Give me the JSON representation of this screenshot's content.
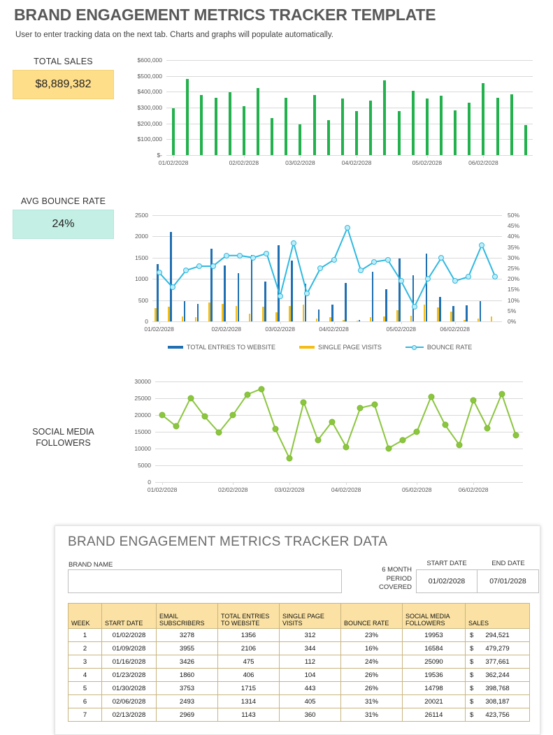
{
  "header": {
    "title": "BRAND ENGAGEMENT METRICS TRACKER TEMPLATE",
    "subtitle": "User to enter tracking data on the next tab. Charts and graphs will populate automatically."
  },
  "kpis": {
    "total_sales_label": "TOTAL SALES",
    "total_sales_value": "$8,889,382",
    "total_sales_color": "#FFDE8A",
    "bounce_label": "AVG BOUNCE RATE",
    "bounce_value": "24%",
    "bounce_color": "#C4EFE4",
    "social_label_line1": "SOCIAL MEDIA",
    "social_label_line2": "FOLLOWERS"
  },
  "legend2": {
    "item1": "TOTAL ENTRIES TO WEBSITE",
    "item2": "SINGLE PAGE VISITS",
    "item3": "BOUNCE RATE",
    "color1": "#1F6FB2",
    "color2": "#F5BE17",
    "color3": "#2FB9E0"
  },
  "data_card": {
    "title": "BRAND ENGAGEMENT METRICS TRACKER DATA",
    "brand_name_label": "BRAND NAME",
    "brand_name_value": "",
    "brand_name_placeholder": "",
    "period_label": "6 MONTH PERIOD COVERED",
    "start_date_label": "START DATE",
    "end_date_label": "END DATE",
    "start_date_value": "01/02/2028",
    "end_date_value": "07/01/2028",
    "columns": [
      "WEEK",
      "START DATE",
      "EMAIL SUBSCRIBERS",
      "TOTAL ENTRIES TO WEBSITE",
      "SINGLE PAGE VISITS",
      "BOUNCE RATE",
      "SOCIAL MEDIA FOLLOWERS",
      "SALES"
    ],
    "rows": [
      {
        "week": "1",
        "start_date": "01/02/2028",
        "email": "3278",
        "entries": "1356",
        "single": "312",
        "bounce": "23%",
        "followers": "19953",
        "sales": "294,521"
      },
      {
        "week": "2",
        "start_date": "01/09/2028",
        "email": "3955",
        "entries": "2106",
        "single": "344",
        "bounce": "16%",
        "followers": "16584",
        "sales": "479,279"
      },
      {
        "week": "3",
        "start_date": "01/16/2028",
        "email": "3426",
        "entries": "475",
        "single": "112",
        "bounce": "24%",
        "followers": "25090",
        "sales": "377,661"
      },
      {
        "week": "4",
        "start_date": "01/23/2028",
        "email": "1860",
        "entries": "406",
        "single": "104",
        "bounce": "26%",
        "followers": "19536",
        "sales": "362,244"
      },
      {
        "week": "5",
        "start_date": "01/30/2028",
        "email": "3753",
        "entries": "1715",
        "single": "443",
        "bounce": "26%",
        "followers": "14798",
        "sales": "398,768"
      },
      {
        "week": "6",
        "start_date": "02/06/2028",
        "email": "2493",
        "entries": "1314",
        "single": "405",
        "bounce": "31%",
        "followers": "20021",
        "sales": "308,187"
      },
      {
        "week": "7",
        "start_date": "02/13/2028",
        "email": "2969",
        "entries": "1143",
        "single": "360",
        "bounce": "31%",
        "followers": "26114",
        "sales": "423,756"
      }
    ],
    "currency_symbol": "$"
  },
  "chart_data": [
    {
      "type": "bar",
      "id": "sales-chart",
      "title": "",
      "xlabel": "",
      "ylabel": "",
      "ylim": [
        0,
        600000
      ],
      "yticks": [
        "$-",
        "$100,000",
        "$200,000",
        "$300,000",
        "$400,000",
        "$500,000",
        "$600,000"
      ],
      "ytick_values": [
        0,
        100000,
        200000,
        300000,
        400000,
        500000,
        600000
      ],
      "xticks": [
        "01/02/2028",
        "02/02/2028",
        "03/02/2028",
        "04/02/2028",
        "05/02/2028",
        "06/02/2028"
      ],
      "xtick_indices": [
        0,
        5,
        9,
        13,
        18,
        22
      ],
      "grid": true,
      "legend": "none",
      "color": "#22B14C",
      "categories": [
        "1",
        "2",
        "3",
        "4",
        "5",
        "6",
        "7",
        "8",
        "9",
        "10",
        "11",
        "12",
        "13",
        "14",
        "15",
        "16",
        "17",
        "18",
        "19",
        "20",
        "21",
        "22",
        "23",
        "24",
        "25",
        "26"
      ],
      "values": [
        294521,
        479279,
        377661,
        362244,
        398768,
        308187,
        423756,
        234000,
        361000,
        193000,
        378000,
        222000,
        357000,
        277000,
        344000,
        470000,
        277000,
        407000,
        356000,
        377000,
        281000,
        331000,
        453000,
        361000,
        382000,
        189000
      ]
    },
    {
      "type": "bar-line-combo",
      "id": "traffic-chart",
      "title": "",
      "xlabel": "",
      "ylim": [
        0,
        2500
      ],
      "yticks": [
        "0",
        "500",
        "1000",
        "1500",
        "2000",
        "2500"
      ],
      "ytick_values": [
        0,
        500,
        1000,
        1500,
        2000,
        2500
      ],
      "y2lim": [
        0,
        0.5
      ],
      "y2ticks": [
        "0%",
        "5%",
        "10%",
        "15%",
        "20%",
        "25%",
        "30%",
        "35%",
        "40%",
        "45%",
        "50%"
      ],
      "y2tick_values": [
        0,
        5,
        10,
        15,
        20,
        25,
        30,
        35,
        40,
        45,
        50
      ],
      "xticks": [
        "01/02/2028",
        "02/02/2028",
        "03/02/2028",
        "04/02/2028",
        "05/02/2028",
        "06/02/2028"
      ],
      "xtick_indices": [
        0,
        5,
        9,
        13,
        18,
        22
      ],
      "grid": true,
      "legend": "bottom",
      "series": [
        {
          "name": "TOTAL ENTRIES TO WEBSITE",
          "type": "bar",
          "color": "#1F6FB2",
          "axis": "left",
          "values": [
            1356,
            2106,
            475,
            406,
            1715,
            1314,
            1143,
            1568,
            940,
            1790,
            1430,
            880,
            280,
            400,
            910,
            30,
            1160,
            760,
            1480,
            1090,
            1600,
            570,
            360,
            380,
            480,
            0
          ]
        },
        {
          "name": "SINGLE PAGE VISITS",
          "type": "bar",
          "color": "#F5BE17",
          "axis": "left",
          "values": [
            312,
            344,
            112,
            104,
            443,
            405,
            360,
            185,
            350,
            220,
            360,
            390,
            70,
            95,
            25,
            15,
            95,
            120,
            270,
            125,
            390,
            330,
            230,
            40,
            70,
            110
          ]
        },
        {
          "name": "BOUNCE RATE",
          "type": "line",
          "color": "#2FB9E0",
          "axis": "right",
          "values": [
            23,
            16,
            24,
            26,
            26,
            31,
            31,
            30,
            32,
            12,
            37,
            13,
            25,
            29,
            44,
            24,
            28,
            29,
            19,
            7,
            20,
            30,
            19,
            21,
            36,
            21
          ]
        }
      ],
      "bounce_rate_percent_values": [
        23,
        16,
        24,
        26,
        26,
        31,
        31,
        30,
        32,
        12,
        37,
        13,
        25,
        29,
        44,
        24,
        28,
        29,
        19,
        7,
        20,
        30,
        19,
        21,
        36,
        21
      ]
    },
    {
      "type": "line",
      "id": "social-followers-chart",
      "title": "",
      "xlabel": "",
      "ylim": [
        0,
        30000
      ],
      "yticks": [
        "0",
        "5000",
        "10000",
        "15000",
        "20000",
        "25000",
        "30000"
      ],
      "ytick_values": [
        0,
        5000,
        10000,
        15000,
        20000,
        25000,
        30000
      ],
      "xticks": [
        "01/02/2028",
        "02/02/2028",
        "03/02/2028",
        "04/02/2028",
        "05/02/2028",
        "06/02/2028"
      ],
      "xtick_indices": [
        0,
        5,
        9,
        13,
        18,
        22
      ],
      "grid": true,
      "legend": "none",
      "color": "#8CC63F",
      "categories": [
        "1",
        "2",
        "3",
        "4",
        "5",
        "6",
        "7",
        "8",
        "9",
        "10",
        "11",
        "12",
        "13",
        "14",
        "15",
        "16",
        "17",
        "18",
        "19",
        "20",
        "21",
        "22",
        "23",
        "24",
        "25",
        "26"
      ],
      "values": [
        19953,
        16584,
        25090,
        19536,
        14798,
        20021,
        26114,
        27800,
        15800,
        7000,
        23800,
        12500,
        18000,
        10500,
        22100,
        23100,
        10100,
        12500,
        15000,
        25400,
        17000,
        11100,
        24400,
        16100,
        26300,
        14000
      ]
    }
  ]
}
